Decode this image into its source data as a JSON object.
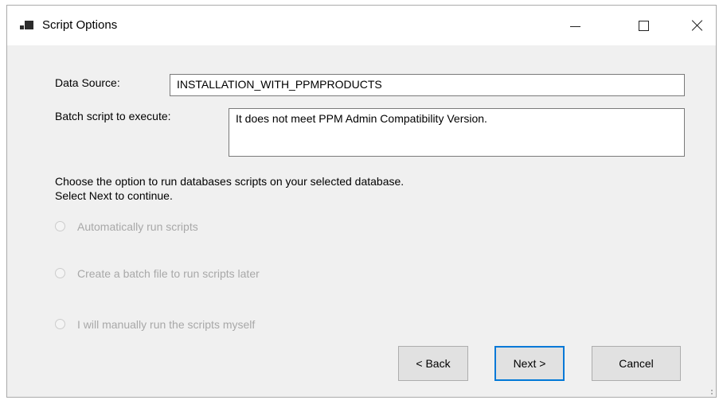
{
  "window": {
    "title": "Script Options"
  },
  "form": {
    "data_source_label": "Data Source:",
    "data_source_value": "INSTALLATION_WITH_PPMPRODUCTS",
    "batch_label": "Batch script to execute:",
    "batch_value": "It does not meet PPM Admin Compatibility Version.",
    "instructions": [
      "Choose the option to run databases scripts on your selected database.",
      "Select Next to continue."
    ],
    "options": [
      {
        "label": "Automatically run scripts",
        "enabled": false,
        "selected": false
      },
      {
        "label": "Create a batch file to run scripts later",
        "enabled": false,
        "selected": false
      },
      {
        "label": "I will manually run the scripts myself",
        "enabled": false,
        "selected": false
      }
    ]
  },
  "buttons": {
    "back": "< Back",
    "next": "Next >",
    "cancel": "Cancel"
  },
  "colors": {
    "focus_border": "#0078d7",
    "disabled_text": "#a8a8a8",
    "dialog_bg": "#f0f0f0"
  }
}
